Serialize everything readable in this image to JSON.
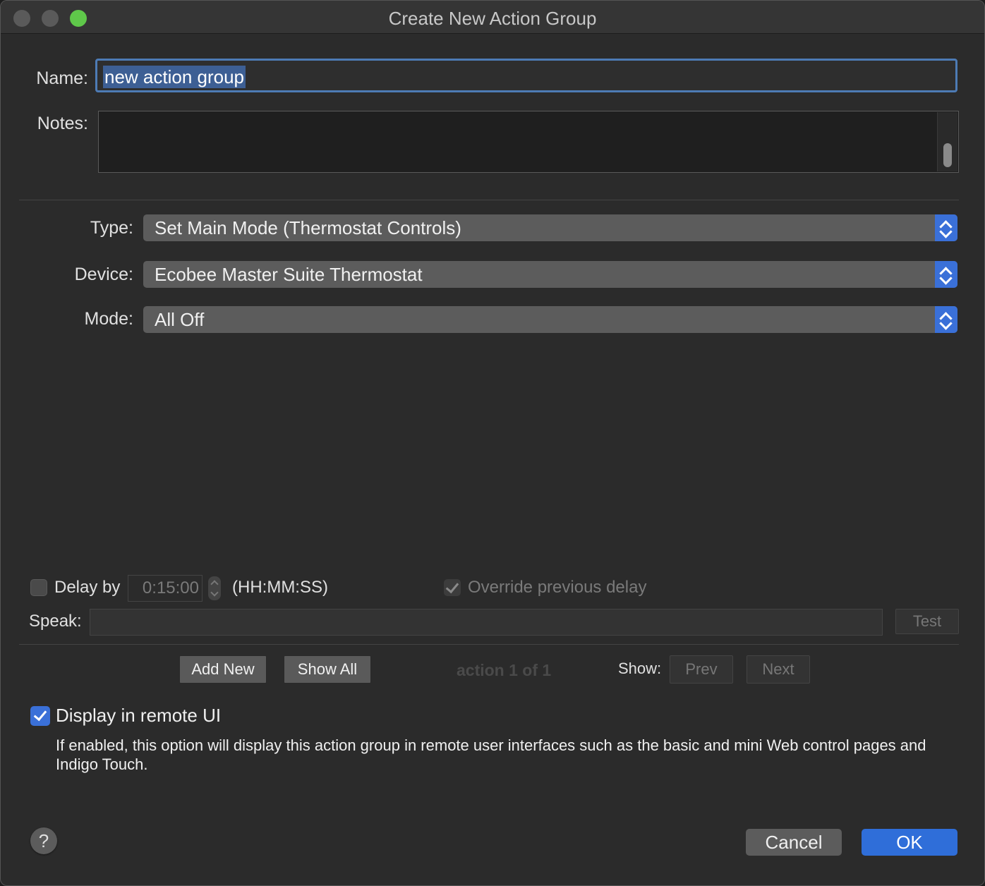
{
  "window": {
    "title": "Create New Action Group"
  },
  "form": {
    "name_label": "Name:",
    "name_value": "new action group",
    "notes_label": "Notes:",
    "notes_value": "",
    "type_label": "Type:",
    "type_value": "Set Main Mode (Thermostat Controls)",
    "device_label": "Device:",
    "device_value": "Ecobee Master Suite Thermostat",
    "mode_label": "Mode:",
    "mode_value": "All Off"
  },
  "delay": {
    "checkbox_label": "Delay by",
    "checked": false,
    "value": "0:15:00",
    "unit": "(HH:MM:SS)",
    "override_label": "Override previous delay",
    "override_checked": true
  },
  "speak": {
    "label": "Speak:",
    "value": "",
    "test_label": "Test"
  },
  "actions_nav": {
    "add_new": "Add New",
    "show_all": "Show All",
    "counter": "action 1 of 1",
    "show_label": "Show:",
    "prev": "Prev",
    "next": "Next"
  },
  "remote_ui": {
    "label": "Display in remote UI",
    "checked": true,
    "description": "If enabled, this option will display this action group in remote user interfaces such as the basic and mini Web control pages and Indigo Touch."
  },
  "footer": {
    "help": "?",
    "cancel": "Cancel",
    "ok": "OK"
  },
  "colors": {
    "accent": "#3a70d8",
    "focus_ring": "#4d7bb5",
    "zoom_light": "#5fc84a"
  }
}
